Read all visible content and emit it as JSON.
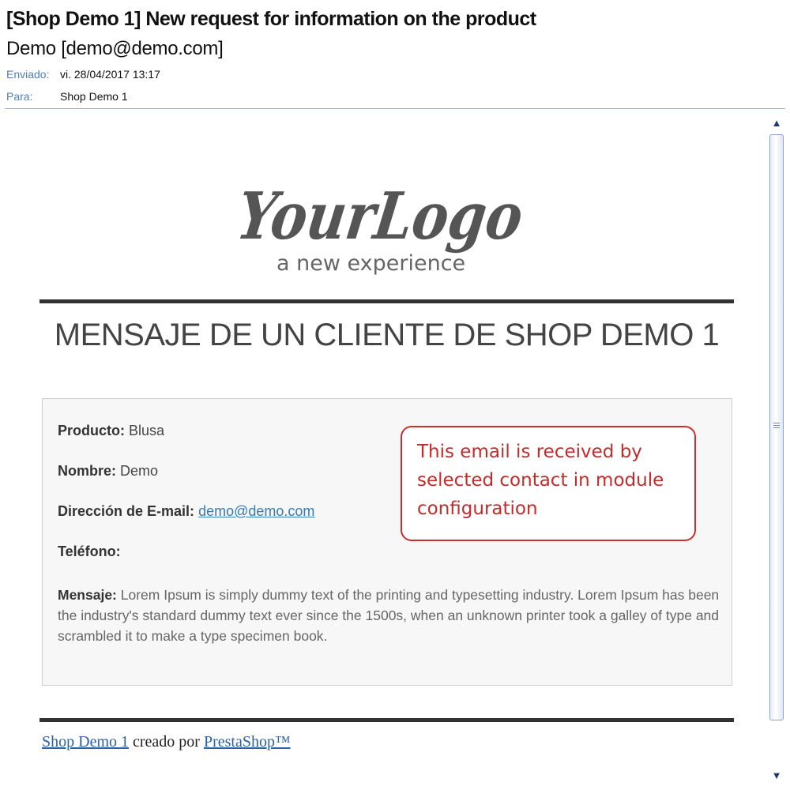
{
  "email": {
    "subject": "[Shop Demo 1] New request for information on the product",
    "sender": "Demo [demo@demo.com]",
    "sent_label": "Enviado:",
    "sent_value": "vi. 28/04/2017 13:17",
    "to_label": "Para:",
    "to_value": "Shop Demo 1"
  },
  "logo": {
    "main": "YourLogo",
    "tagline": "a new experience"
  },
  "body": {
    "title": "MENSAJE DE UN CLIENTE DE SHOP DEMO 1",
    "product_label": "Producto:",
    "product_value": "Blusa",
    "name_label": "Nombre:",
    "name_value": "Demo",
    "email_label": "Dirección de E-mail:",
    "email_value": "demo@demo.com",
    "phone_label": "Teléfono:",
    "message_label": "Mensaje:",
    "message_value": "Lorem Ipsum is simply dummy text of the printing and typesetting industry. Lorem Ipsum has been the industry's standard dummy text ever since the 1500s, when an unknown printer took a galley of type and scrambled it to make a type specimen book."
  },
  "callout": {
    "text": "This email is received by selected contact in module configuration",
    "border_color": "#c9302c"
  },
  "footer": {
    "shop_link": "Shop Demo 1",
    "created_by": "creado por",
    "prestashop_link": "PrestaShop™"
  },
  "scrollbar": {
    "up_icon": "arrow-up-icon",
    "down_icon": "arrow-down-icon"
  }
}
